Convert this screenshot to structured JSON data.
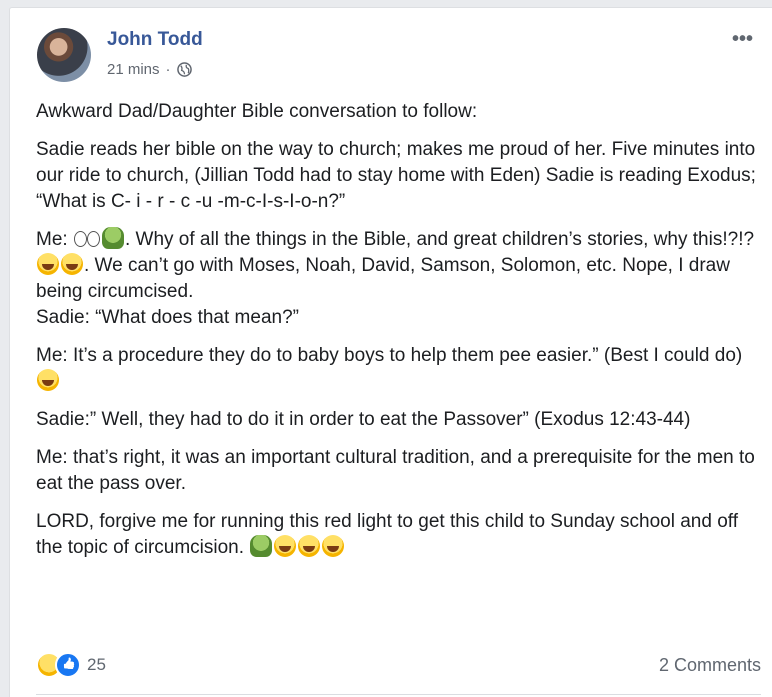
{
  "post": {
    "author": "John Todd",
    "time": "21 mins",
    "separator": "·",
    "more_label": "•••",
    "paragraphs": {
      "p1": "Awkward Dad/Daughter Bible conversation to follow:",
      "p2a": "Sadie reads her bible on the way to church; makes me proud of her. Five minutes into our ride to church, (Jillian Todd had to stay home with Eden) Sadie is reading Exodus;",
      "p2b": "“What is C- i - r - c -u -m-c-I-s-I-o-n?”",
      "p3a_pre": "Me: ",
      "p3a_post": ". Why of all the things in the Bible, and great children’s stories, why this!?!? ",
      "p3a_end": ". We can’t go with Moses, Noah, David, Samson, Solomon, etc. Nope, I draw being circumcised.",
      "p3b": "Sadie: “What does that mean?”",
      "p4": "Me: It’s a procedure they do to baby boys to help them pee easier.” (Best I could do) ",
      "p5": "Sadie:” Well, they had to do it in order to eat the Passover” (Exodus 12:43-44)",
      "p6": "Me: that’s right, it was an important cultural tradition, and a prerequisite for the men to eat the pass over.",
      "p7": "LORD, forgive me for running this red light to get this child to Sunday school and off the topic of circumcision. "
    },
    "reaction_count": "25",
    "comments_label": "2 Comments"
  },
  "icons": {
    "avatar": "profile-photo",
    "privacy": "globe-icon",
    "reactions": [
      "haha-reaction-icon",
      "like-reaction-icon"
    ],
    "emojis": [
      "eyes-emoji",
      "nauseated-emoji",
      "tears-of-joy-emoji"
    ]
  },
  "colors": {
    "author": "#385898",
    "text": "#1c1e21",
    "meta": "#616770",
    "like_blue": "#1877f2"
  }
}
